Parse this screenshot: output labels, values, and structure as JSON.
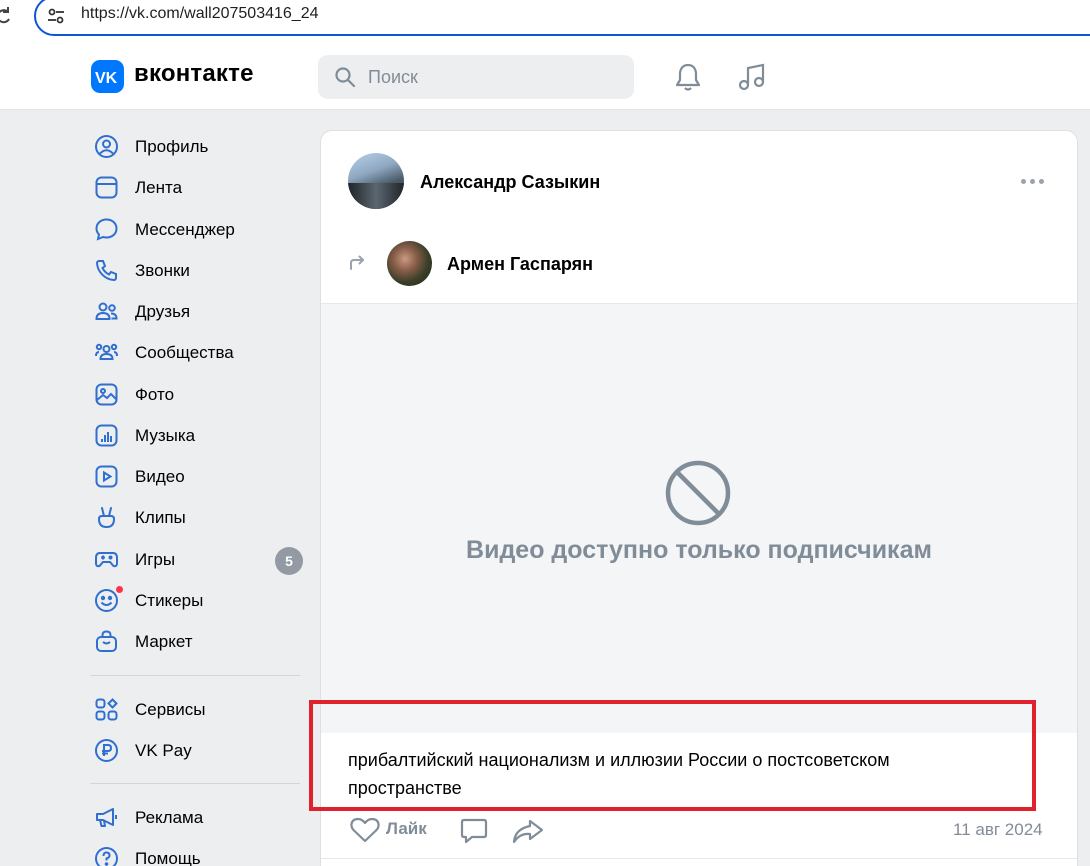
{
  "browser": {
    "url": "https://vk.com/wall207503416_24"
  },
  "header": {
    "logo_text": "вконтакте",
    "search_placeholder": "Поиск"
  },
  "sidebar": {
    "items": [
      {
        "label": "Профиль",
        "icon": "profile-icon"
      },
      {
        "label": "Лента",
        "icon": "feed-icon"
      },
      {
        "label": "Мессенджер",
        "icon": "messenger-icon"
      },
      {
        "label": "Звонки",
        "icon": "phone-icon"
      },
      {
        "label": "Друзья",
        "icon": "friends-icon"
      },
      {
        "label": "Сообщества",
        "icon": "communities-icon"
      },
      {
        "label": "Фото",
        "icon": "photo-icon"
      },
      {
        "label": "Музыка",
        "icon": "music-icon"
      },
      {
        "label": "Видео",
        "icon": "video-icon"
      },
      {
        "label": "Клипы",
        "icon": "clips-icon"
      },
      {
        "label": "Игры",
        "icon": "games-icon",
        "badge": "5"
      },
      {
        "label": "Стикеры",
        "icon": "stickers-icon"
      },
      {
        "label": "Маркет",
        "icon": "market-icon"
      },
      {
        "label": "Сервисы",
        "icon": "services-icon"
      },
      {
        "label": "VK Pay",
        "icon": "vkpay-icon"
      },
      {
        "label": "Реклама",
        "icon": "ads-icon"
      },
      {
        "label": "Помощь",
        "icon": "help-icon"
      }
    ]
  },
  "post": {
    "author": "Александр Сазыкин",
    "repost_author": "Армен Гаспарян",
    "video_message": "Видео доступно только подписчикам",
    "text": "прибалтийский национализм и иллюзии России о постсоветском пространстве",
    "like_label": "Лайк",
    "date": "11 авг 2024"
  },
  "colors": {
    "accent": "#0077ff",
    "highlight": "#e0212e",
    "muted": "#818c99"
  }
}
